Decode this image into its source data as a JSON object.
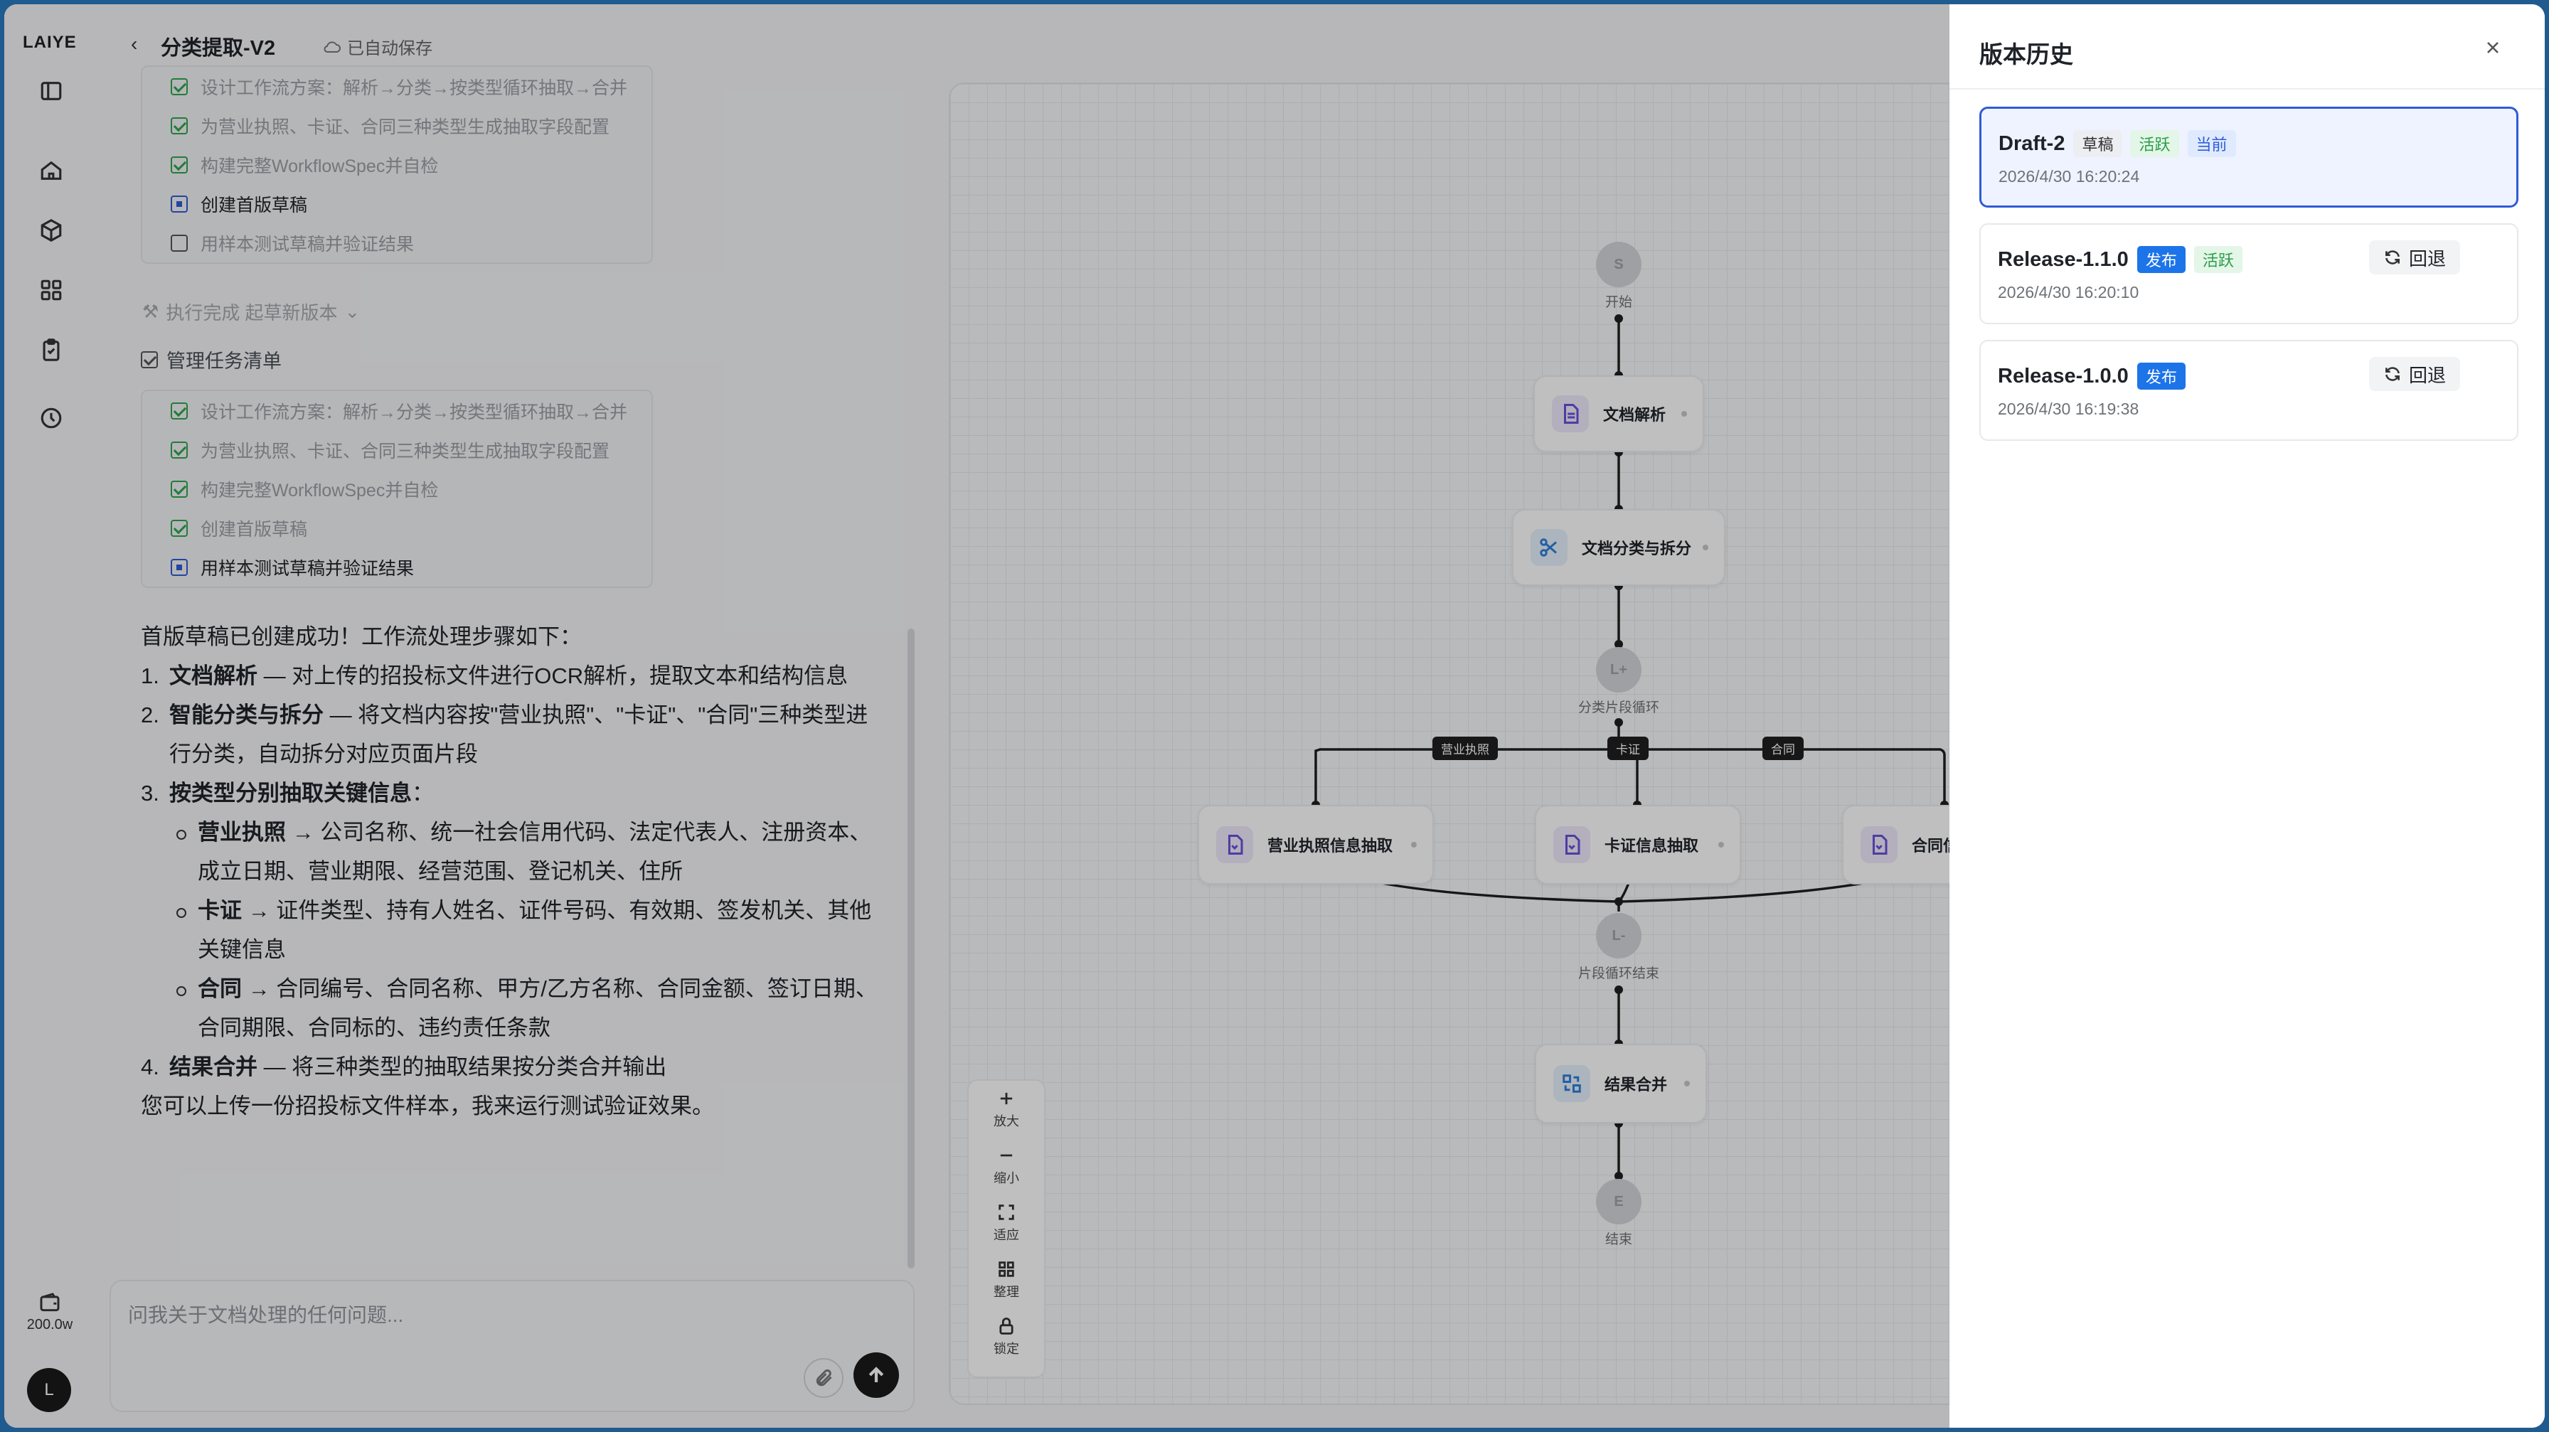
{
  "app": {
    "logo": "LAIYE",
    "quota": "200.0w",
    "avatar": "L"
  },
  "header": {
    "title": "分类提取-V2",
    "autosave": "已自动保存"
  },
  "chat": {
    "task_list_1": [
      {
        "text": "设计工作流方案：解析→分类→按类型循环抽取→合并",
        "state": "done"
      },
      {
        "text": "为营业执照、卡证、合同三种类型生成抽取字段配置",
        "state": "done"
      },
      {
        "text": "构建完整WorkflowSpec并自检",
        "state": "done"
      },
      {
        "text": "创建首版草稿",
        "state": "doing"
      },
      {
        "text": "用样本测试草稿并验证结果",
        "state": "todo"
      }
    ],
    "exec_status": "执行完成 起草新版本",
    "manage_label": "管理任务清单",
    "task_list_2": [
      {
        "text": "设计工作流方案：解析→分类→按类型循环抽取→合并",
        "state": "done"
      },
      {
        "text": "为营业执照、卡证、合同三种类型生成抽取字段配置",
        "state": "done"
      },
      {
        "text": "构建完整WorkflowSpec并自检",
        "state": "done"
      },
      {
        "text": "创建首版草稿",
        "state": "done"
      },
      {
        "text": "用样本测试草稿并验证结果",
        "state": "doing"
      }
    ],
    "answer": {
      "intro": "首版草稿已创建成功！工作流处理步骤如下：",
      "steps": [
        {
          "num": "1.",
          "bold": "文档解析",
          "text": " — 对上传的招投标文件进行OCR解析，提取文本和结构信息"
        },
        {
          "num": "2.",
          "bold": "智能分类与拆分",
          "text": " — 将文档内容按\"营业执照\"、\"卡证\"、\"合同\"三种类型进行分类，自动拆分对应页面片段"
        },
        {
          "num": "3.",
          "bold": "按类型分别抽取关键信息",
          "text": "："
        }
      ],
      "subs": [
        {
          "bold": "营业执照",
          "text": " → 公司名称、统一社会信用代码、法定代表人、注册资本、成立日期、营业期限、经营范围、登记机关、住所"
        },
        {
          "bold": "卡证",
          "text": " → 证件类型、持有人姓名、证件号码、有效期、签发机关、其他关键信息"
        },
        {
          "bold": "合同",
          "text": " → 合同编号、合同名称、甲方/乙方名称、合同金额、签订日期、合同期限、合同标的、违约责任条款"
        }
      ],
      "step4": {
        "num": "4.",
        "bold": "结果合并",
        "text": " — 将三种类型的抽取结果按分类合并输出"
      },
      "outro": "您可以上传一份招投标文件样本，我来运行测试验证效果。"
    },
    "input_placeholder": "问我关于文档处理的任何问题..."
  },
  "canvas": {
    "start": {
      "badge": "S",
      "label": "开始"
    },
    "parse": "文档解析",
    "classify": "文档分类与拆分",
    "loop": {
      "badge": "L+",
      "label": "分类片段循环"
    },
    "branches": [
      "营业执照",
      "卡证",
      "合同"
    ],
    "extract_nodes": [
      "营业执照信息抽取",
      "卡证信息抽取",
      "合同信息抽取"
    ],
    "loop_end": {
      "badge": "L-",
      "label": "片段循环结束"
    },
    "merge": "结果合并",
    "end": {
      "badge": "E",
      "label": "结束"
    },
    "zoom": {
      "zoom_in": "放大",
      "zoom_out": "缩小",
      "fit": "适应",
      "arrange": "整理",
      "lock": "锁定"
    }
  },
  "drawer": {
    "title": "版本历史",
    "versions": [
      {
        "name": "Draft-2",
        "tags": [
          "草稿",
          "活跃",
          "当前"
        ],
        "time": "2026/4/30 16:20:24"
      },
      {
        "name": "Release-1.1.0",
        "tags": [
          "发布",
          "活跃"
        ],
        "time": "2026/4/30 16:20:10",
        "action": "回退"
      },
      {
        "name": "Release-1.0.0",
        "tags": [
          "发布"
        ],
        "time": "2026/4/30 16:19:38",
        "action": "回退"
      }
    ]
  },
  "colors": {
    "accent": "#2f5bd8",
    "release": "#1c74e8",
    "active": "#2d9c4a",
    "frame": "#1f5b8f"
  }
}
